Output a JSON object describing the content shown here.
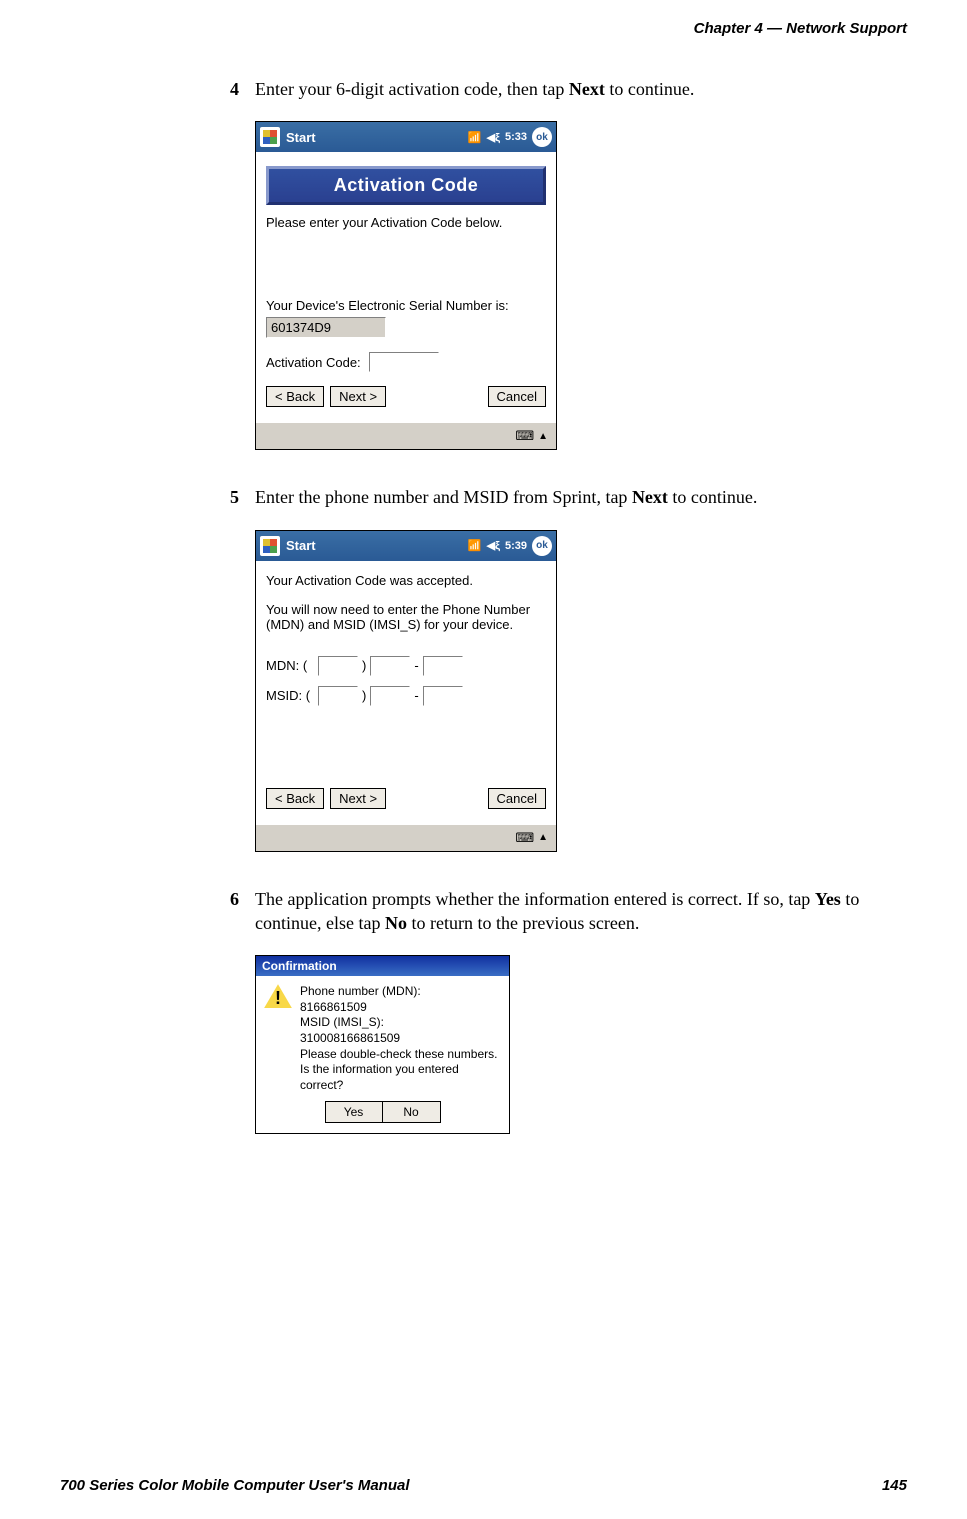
{
  "header": {
    "chapter": "Chapter  4",
    "sep": "  —  ",
    "title": "Network Support"
  },
  "steps": {
    "s4": {
      "num": "4",
      "pre": "Enter your 6-digit activation code, then tap ",
      "bold": "Next",
      "post": " to continue."
    },
    "s5": {
      "num": "5",
      "pre": "Enter the phone number and MSID from Sprint, tap ",
      "bold": "Next",
      "post": " to continue."
    },
    "s6": {
      "num": "6",
      "pre": "The application prompts whether the information entered is correct. If so, tap ",
      "bold1": "Yes",
      "mid": " to continue, else tap ",
      "bold2": "No",
      "post": " to return to the previous screen."
    }
  },
  "screen1": {
    "start": "Start",
    "time": "5:33",
    "ok": "ok",
    "banner": "Activation Code",
    "prompt": "Please enter your Activation Code below.",
    "esn_label": "Your Device's Electronic Serial Number is:",
    "esn_value": "601374D9",
    "code_label": "Activation Code:",
    "back": "< Back",
    "next": "Next >",
    "cancel": "Cancel"
  },
  "screen2": {
    "start": "Start",
    "time": "5:39",
    "ok": "ok",
    "msg1": "Your Activation Code was accepted.",
    "msg2": "You will now need to enter the Phone Number (MDN) and MSID (IMSI_S) for your device.",
    "mdn": "MDN: (",
    "msid": "MSID: (",
    "paren": ")",
    "dash": "-",
    "back": "< Back",
    "next": "Next >",
    "cancel": "Cancel"
  },
  "dialog": {
    "title": "Confirmation",
    "l1": "Phone number (MDN):",
    "l2": "8166861509",
    "l3": "MSID (IMSI_S):",
    "l4": "310008166861509",
    "l5": "Please double-check these numbers.",
    "l6": "Is the information you entered correct?",
    "yes": "Yes",
    "no": "No"
  },
  "footer": {
    "manual": "700 Series Color Mobile Computer User's Manual",
    "page": "145"
  }
}
